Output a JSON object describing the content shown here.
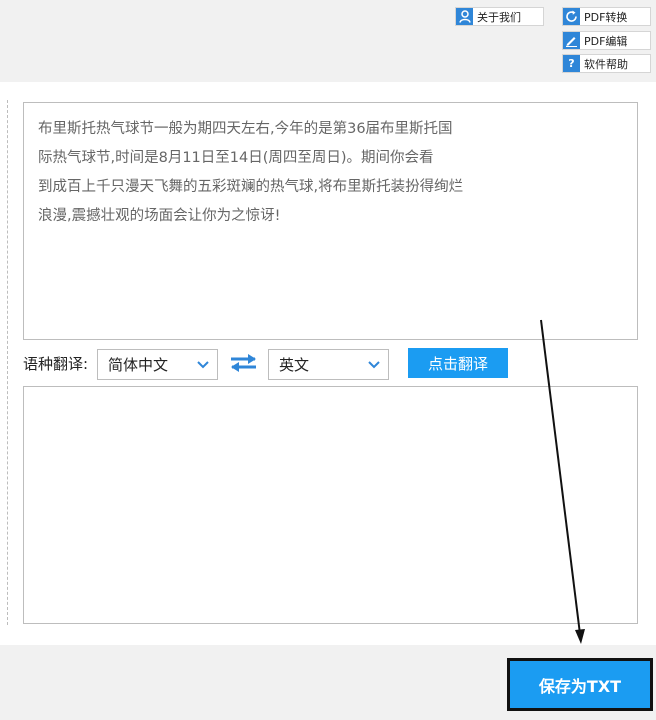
{
  "toolbar": {
    "about_label": "关于我们",
    "pdf_convert_label": "PDF转换",
    "pdf_edit_label": "PDF编辑",
    "help_label": "软件帮助",
    "help_glyph": "?"
  },
  "source": {
    "lines": [
      "布里斯托热气球节一般为期四天左右,今年的是第36届布里斯托国",
      "际热气球节,时间是8月11日至14日(周四至周日)。期间你会看",
      "到成百上千只漫天飞舞的五彩斑斓的热气球,将布里斯托装扮得绚烂",
      "浪漫,震撼壮观的场面会让你为之惊讶!"
    ]
  },
  "translate": {
    "label": "语种翻译:",
    "from_lang": "简体中文",
    "to_lang": "英文",
    "button_label": "点击翻译"
  },
  "output": {
    "text": ""
  },
  "footer": {
    "save_label": "保存为TXT"
  },
  "colors": {
    "accent": "#1b9cf2",
    "icon_blue": "#2f86d8",
    "panel_bg": "#f1f1f1",
    "border": "#bdbdbd"
  }
}
